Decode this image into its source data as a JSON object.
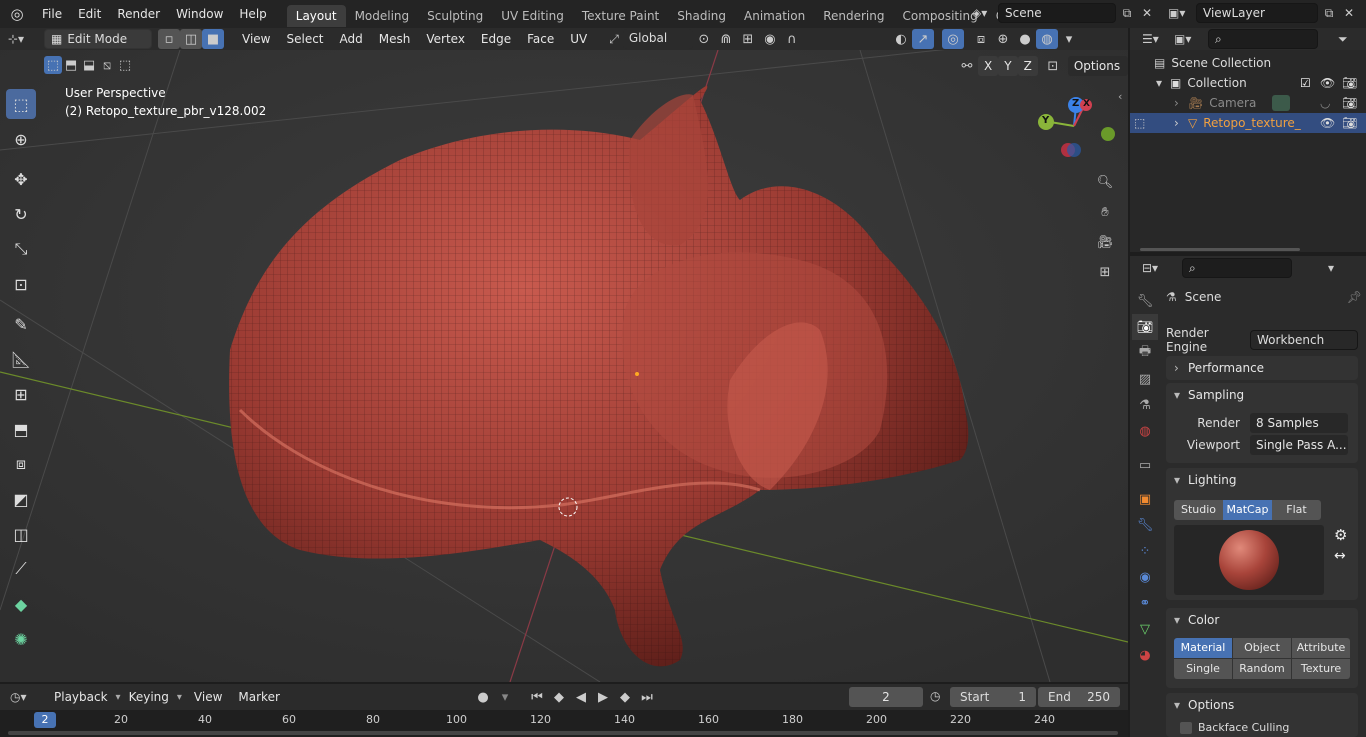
{
  "topbar": {
    "menus": [
      "File",
      "Edit",
      "Render",
      "Window",
      "Help"
    ],
    "workspaces": [
      "Layout",
      "Modeling",
      "Sculpting",
      "UV Editing",
      "Texture Paint",
      "Shading",
      "Animation",
      "Rendering",
      "Compositing",
      "Geometry Noc"
    ],
    "scene": "Scene",
    "view_layer": "ViewLayer"
  },
  "viewport_header": {
    "mode": "Edit Mode",
    "menus": [
      "View",
      "Select",
      "Add",
      "Mesh",
      "Vertex",
      "Edge",
      "Face",
      "UV"
    ],
    "transform_orientation": "Global",
    "axes": [
      "X",
      "Y",
      "Z"
    ],
    "options": "Options"
  },
  "viewport": {
    "perspective": "User Perspective",
    "object_info": "(2) Retopo_texture_pbr_v128.002",
    "gizmo": {
      "x": "X",
      "y": "Y",
      "z": "Z"
    }
  },
  "outliner": {
    "root": "Scene Collection",
    "collection": "Collection",
    "items": [
      "Camera",
      "Retopo_texture_"
    ]
  },
  "properties": {
    "context": "Scene",
    "render_engine_label": "Render Engine",
    "render_engine": "Workbench",
    "performance": "Performance",
    "sampling": "Sampling",
    "render_label": "Render",
    "render_value": "8 Samples",
    "viewport_label": "Viewport",
    "viewport_value": "Single Pass A...",
    "lighting": "Lighting",
    "lighting_modes": [
      "Studio",
      "MatCap",
      "Flat"
    ],
    "color": "Color",
    "color_modes_row1": [
      "Material",
      "Object",
      "Attribute"
    ],
    "color_modes_row2": [
      "Single",
      "Random",
      "Texture"
    ],
    "options": "Options",
    "backface": "Backface Culling"
  },
  "timeline": {
    "menus": [
      "Playback",
      "Keying",
      "View",
      "Marker"
    ],
    "current_frame": "2",
    "start_label": "Start",
    "start": "1",
    "end_label": "End",
    "end": "250",
    "ticks": [
      "20",
      "40",
      "60",
      "80",
      "100",
      "120",
      "140",
      "160",
      "180",
      "200",
      "220",
      "240"
    ]
  }
}
